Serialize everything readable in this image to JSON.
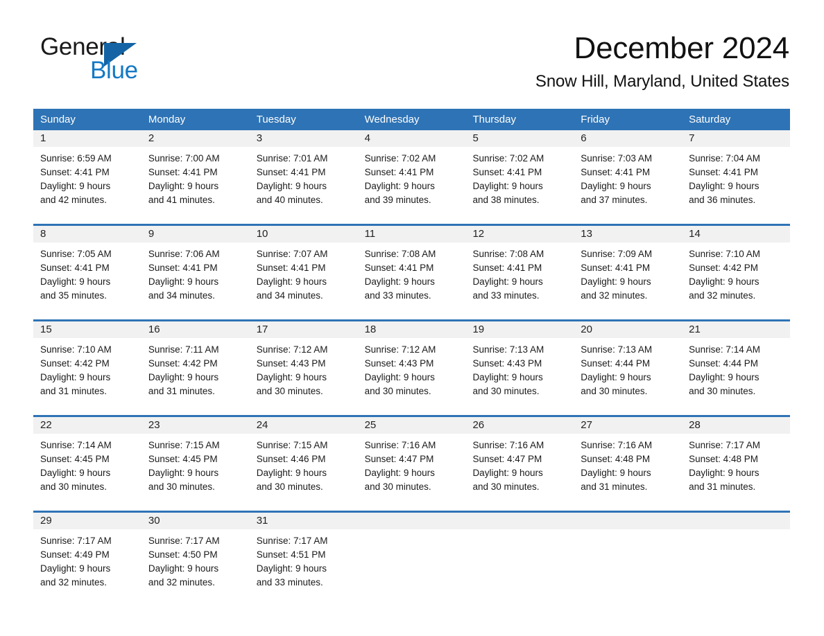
{
  "brand": {
    "name_part1": "General",
    "name_part2": "Blue",
    "accent_color": "#1479c4",
    "triangle_color": "#1464a5"
  },
  "header": {
    "month_title": "December 2024",
    "location": "Snow Hill, Maryland, United States"
  },
  "theme": {
    "header_blue": "#2e73b5",
    "day_band_gray": "#f1f1f1",
    "text_black": "#1a1a1a"
  },
  "weekdays": [
    "Sunday",
    "Monday",
    "Tuesday",
    "Wednesday",
    "Thursday",
    "Friday",
    "Saturday"
  ],
  "weeks": [
    [
      {
        "day": "1",
        "sunrise": "Sunrise: 6:59 AM",
        "sunset": "Sunset: 4:41 PM",
        "daylight1": "Daylight: 9 hours",
        "daylight2": "and 42 minutes."
      },
      {
        "day": "2",
        "sunrise": "Sunrise: 7:00 AM",
        "sunset": "Sunset: 4:41 PM",
        "daylight1": "Daylight: 9 hours",
        "daylight2": "and 41 minutes."
      },
      {
        "day": "3",
        "sunrise": "Sunrise: 7:01 AM",
        "sunset": "Sunset: 4:41 PM",
        "daylight1": "Daylight: 9 hours",
        "daylight2": "and 40 minutes."
      },
      {
        "day": "4",
        "sunrise": "Sunrise: 7:02 AM",
        "sunset": "Sunset: 4:41 PM",
        "daylight1": "Daylight: 9 hours",
        "daylight2": "and 39 minutes."
      },
      {
        "day": "5",
        "sunrise": "Sunrise: 7:02 AM",
        "sunset": "Sunset: 4:41 PM",
        "daylight1": "Daylight: 9 hours",
        "daylight2": "and 38 minutes."
      },
      {
        "day": "6",
        "sunrise": "Sunrise: 7:03 AM",
        "sunset": "Sunset: 4:41 PM",
        "daylight1": "Daylight: 9 hours",
        "daylight2": "and 37 minutes."
      },
      {
        "day": "7",
        "sunrise": "Sunrise: 7:04 AM",
        "sunset": "Sunset: 4:41 PM",
        "daylight1": "Daylight: 9 hours",
        "daylight2": "and 36 minutes."
      }
    ],
    [
      {
        "day": "8",
        "sunrise": "Sunrise: 7:05 AM",
        "sunset": "Sunset: 4:41 PM",
        "daylight1": "Daylight: 9 hours",
        "daylight2": "and 35 minutes."
      },
      {
        "day": "9",
        "sunrise": "Sunrise: 7:06 AM",
        "sunset": "Sunset: 4:41 PM",
        "daylight1": "Daylight: 9 hours",
        "daylight2": "and 34 minutes."
      },
      {
        "day": "10",
        "sunrise": "Sunrise: 7:07 AM",
        "sunset": "Sunset: 4:41 PM",
        "daylight1": "Daylight: 9 hours",
        "daylight2": "and 34 minutes."
      },
      {
        "day": "11",
        "sunrise": "Sunrise: 7:08 AM",
        "sunset": "Sunset: 4:41 PM",
        "daylight1": "Daylight: 9 hours",
        "daylight2": "and 33 minutes."
      },
      {
        "day": "12",
        "sunrise": "Sunrise: 7:08 AM",
        "sunset": "Sunset: 4:41 PM",
        "daylight1": "Daylight: 9 hours",
        "daylight2": "and 33 minutes."
      },
      {
        "day": "13",
        "sunrise": "Sunrise: 7:09 AM",
        "sunset": "Sunset: 4:41 PM",
        "daylight1": "Daylight: 9 hours",
        "daylight2": "and 32 minutes."
      },
      {
        "day": "14",
        "sunrise": "Sunrise: 7:10 AM",
        "sunset": "Sunset: 4:42 PM",
        "daylight1": "Daylight: 9 hours",
        "daylight2": "and 32 minutes."
      }
    ],
    [
      {
        "day": "15",
        "sunrise": "Sunrise: 7:10 AM",
        "sunset": "Sunset: 4:42 PM",
        "daylight1": "Daylight: 9 hours",
        "daylight2": "and 31 minutes."
      },
      {
        "day": "16",
        "sunrise": "Sunrise: 7:11 AM",
        "sunset": "Sunset: 4:42 PM",
        "daylight1": "Daylight: 9 hours",
        "daylight2": "and 31 minutes."
      },
      {
        "day": "17",
        "sunrise": "Sunrise: 7:12 AM",
        "sunset": "Sunset: 4:43 PM",
        "daylight1": "Daylight: 9 hours",
        "daylight2": "and 30 minutes."
      },
      {
        "day": "18",
        "sunrise": "Sunrise: 7:12 AM",
        "sunset": "Sunset: 4:43 PM",
        "daylight1": "Daylight: 9 hours",
        "daylight2": "and 30 minutes."
      },
      {
        "day": "19",
        "sunrise": "Sunrise: 7:13 AM",
        "sunset": "Sunset: 4:43 PM",
        "daylight1": "Daylight: 9 hours",
        "daylight2": "and 30 minutes."
      },
      {
        "day": "20",
        "sunrise": "Sunrise: 7:13 AM",
        "sunset": "Sunset: 4:44 PM",
        "daylight1": "Daylight: 9 hours",
        "daylight2": "and 30 minutes."
      },
      {
        "day": "21",
        "sunrise": "Sunrise: 7:14 AM",
        "sunset": "Sunset: 4:44 PM",
        "daylight1": "Daylight: 9 hours",
        "daylight2": "and 30 minutes."
      }
    ],
    [
      {
        "day": "22",
        "sunrise": "Sunrise: 7:14 AM",
        "sunset": "Sunset: 4:45 PM",
        "daylight1": "Daylight: 9 hours",
        "daylight2": "and 30 minutes."
      },
      {
        "day": "23",
        "sunrise": "Sunrise: 7:15 AM",
        "sunset": "Sunset: 4:45 PM",
        "daylight1": "Daylight: 9 hours",
        "daylight2": "and 30 minutes."
      },
      {
        "day": "24",
        "sunrise": "Sunrise: 7:15 AM",
        "sunset": "Sunset: 4:46 PM",
        "daylight1": "Daylight: 9 hours",
        "daylight2": "and 30 minutes."
      },
      {
        "day": "25",
        "sunrise": "Sunrise: 7:16 AM",
        "sunset": "Sunset: 4:47 PM",
        "daylight1": "Daylight: 9 hours",
        "daylight2": "and 30 minutes."
      },
      {
        "day": "26",
        "sunrise": "Sunrise: 7:16 AM",
        "sunset": "Sunset: 4:47 PM",
        "daylight1": "Daylight: 9 hours",
        "daylight2": "and 30 minutes."
      },
      {
        "day": "27",
        "sunrise": "Sunrise: 7:16 AM",
        "sunset": "Sunset: 4:48 PM",
        "daylight1": "Daylight: 9 hours",
        "daylight2": "and 31 minutes."
      },
      {
        "day": "28",
        "sunrise": "Sunrise: 7:17 AM",
        "sunset": "Sunset: 4:48 PM",
        "daylight1": "Daylight: 9 hours",
        "daylight2": "and 31 minutes."
      }
    ],
    [
      {
        "day": "29",
        "sunrise": "Sunrise: 7:17 AM",
        "sunset": "Sunset: 4:49 PM",
        "daylight1": "Daylight: 9 hours",
        "daylight2": "and 32 minutes."
      },
      {
        "day": "30",
        "sunrise": "Sunrise: 7:17 AM",
        "sunset": "Sunset: 4:50 PM",
        "daylight1": "Daylight: 9 hours",
        "daylight2": "and 32 minutes."
      },
      {
        "day": "31",
        "sunrise": "Sunrise: 7:17 AM",
        "sunset": "Sunset: 4:51 PM",
        "daylight1": "Daylight: 9 hours",
        "daylight2": "and 33 minutes."
      },
      {
        "day": "",
        "sunrise": "",
        "sunset": "",
        "daylight1": "",
        "daylight2": ""
      },
      {
        "day": "",
        "sunrise": "",
        "sunset": "",
        "daylight1": "",
        "daylight2": ""
      },
      {
        "day": "",
        "sunrise": "",
        "sunset": "",
        "daylight1": "",
        "daylight2": ""
      },
      {
        "day": "",
        "sunrise": "",
        "sunset": "",
        "daylight1": "",
        "daylight2": ""
      }
    ]
  ]
}
